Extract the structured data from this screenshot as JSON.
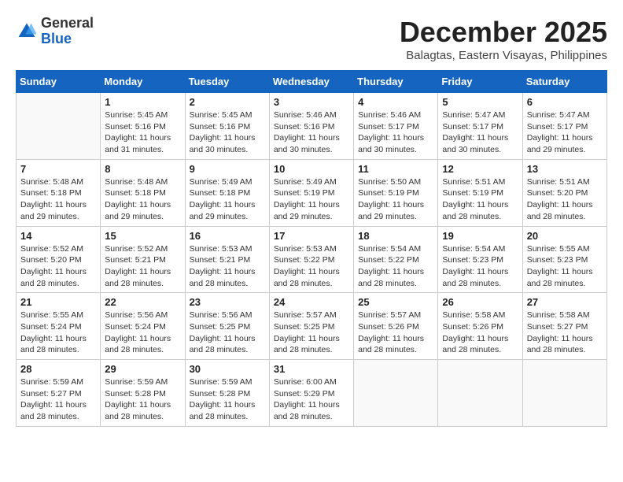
{
  "header": {
    "logo_general": "General",
    "logo_blue": "Blue",
    "month_year": "December 2025",
    "location": "Balagtas, Eastern Visayas, Philippines"
  },
  "days_of_week": [
    "Sunday",
    "Monday",
    "Tuesday",
    "Wednesday",
    "Thursday",
    "Friday",
    "Saturday"
  ],
  "weeks": [
    [
      {
        "day": "",
        "sunrise": "",
        "sunset": "",
        "daylight": ""
      },
      {
        "day": "1",
        "sunrise": "5:45 AM",
        "sunset": "5:16 PM",
        "daylight": "11 hours and 31 minutes."
      },
      {
        "day": "2",
        "sunrise": "5:45 AM",
        "sunset": "5:16 PM",
        "daylight": "11 hours and 30 minutes."
      },
      {
        "day": "3",
        "sunrise": "5:46 AM",
        "sunset": "5:16 PM",
        "daylight": "11 hours and 30 minutes."
      },
      {
        "day": "4",
        "sunrise": "5:46 AM",
        "sunset": "5:17 PM",
        "daylight": "11 hours and 30 minutes."
      },
      {
        "day": "5",
        "sunrise": "5:47 AM",
        "sunset": "5:17 PM",
        "daylight": "11 hours and 30 minutes."
      },
      {
        "day": "6",
        "sunrise": "5:47 AM",
        "sunset": "5:17 PM",
        "daylight": "11 hours and 29 minutes."
      }
    ],
    [
      {
        "day": "7",
        "sunrise": "5:48 AM",
        "sunset": "5:18 PM",
        "daylight": "11 hours and 29 minutes."
      },
      {
        "day": "8",
        "sunrise": "5:48 AM",
        "sunset": "5:18 PM",
        "daylight": "11 hours and 29 minutes."
      },
      {
        "day": "9",
        "sunrise": "5:49 AM",
        "sunset": "5:18 PM",
        "daylight": "11 hours and 29 minutes."
      },
      {
        "day": "10",
        "sunrise": "5:49 AM",
        "sunset": "5:19 PM",
        "daylight": "11 hours and 29 minutes."
      },
      {
        "day": "11",
        "sunrise": "5:50 AM",
        "sunset": "5:19 PM",
        "daylight": "11 hours and 29 minutes."
      },
      {
        "day": "12",
        "sunrise": "5:51 AM",
        "sunset": "5:19 PM",
        "daylight": "11 hours and 28 minutes."
      },
      {
        "day": "13",
        "sunrise": "5:51 AM",
        "sunset": "5:20 PM",
        "daylight": "11 hours and 28 minutes."
      }
    ],
    [
      {
        "day": "14",
        "sunrise": "5:52 AM",
        "sunset": "5:20 PM",
        "daylight": "11 hours and 28 minutes."
      },
      {
        "day": "15",
        "sunrise": "5:52 AM",
        "sunset": "5:21 PM",
        "daylight": "11 hours and 28 minutes."
      },
      {
        "day": "16",
        "sunrise": "5:53 AM",
        "sunset": "5:21 PM",
        "daylight": "11 hours and 28 minutes."
      },
      {
        "day": "17",
        "sunrise": "5:53 AM",
        "sunset": "5:22 PM",
        "daylight": "11 hours and 28 minutes."
      },
      {
        "day": "18",
        "sunrise": "5:54 AM",
        "sunset": "5:22 PM",
        "daylight": "11 hours and 28 minutes."
      },
      {
        "day": "19",
        "sunrise": "5:54 AM",
        "sunset": "5:23 PM",
        "daylight": "11 hours and 28 minutes."
      },
      {
        "day": "20",
        "sunrise": "5:55 AM",
        "sunset": "5:23 PM",
        "daylight": "11 hours and 28 minutes."
      }
    ],
    [
      {
        "day": "21",
        "sunrise": "5:55 AM",
        "sunset": "5:24 PM",
        "daylight": "11 hours and 28 minutes."
      },
      {
        "day": "22",
        "sunrise": "5:56 AM",
        "sunset": "5:24 PM",
        "daylight": "11 hours and 28 minutes."
      },
      {
        "day": "23",
        "sunrise": "5:56 AM",
        "sunset": "5:25 PM",
        "daylight": "11 hours and 28 minutes."
      },
      {
        "day": "24",
        "sunrise": "5:57 AM",
        "sunset": "5:25 PM",
        "daylight": "11 hours and 28 minutes."
      },
      {
        "day": "25",
        "sunrise": "5:57 AM",
        "sunset": "5:26 PM",
        "daylight": "11 hours and 28 minutes."
      },
      {
        "day": "26",
        "sunrise": "5:58 AM",
        "sunset": "5:26 PM",
        "daylight": "11 hours and 28 minutes."
      },
      {
        "day": "27",
        "sunrise": "5:58 AM",
        "sunset": "5:27 PM",
        "daylight": "11 hours and 28 minutes."
      }
    ],
    [
      {
        "day": "28",
        "sunrise": "5:59 AM",
        "sunset": "5:27 PM",
        "daylight": "11 hours and 28 minutes."
      },
      {
        "day": "29",
        "sunrise": "5:59 AM",
        "sunset": "5:28 PM",
        "daylight": "11 hours and 28 minutes."
      },
      {
        "day": "30",
        "sunrise": "5:59 AM",
        "sunset": "5:28 PM",
        "daylight": "11 hours and 28 minutes."
      },
      {
        "day": "31",
        "sunrise": "6:00 AM",
        "sunset": "5:29 PM",
        "daylight": "11 hours and 28 minutes."
      },
      {
        "day": "",
        "sunrise": "",
        "sunset": "",
        "daylight": ""
      },
      {
        "day": "",
        "sunrise": "",
        "sunset": "",
        "daylight": ""
      },
      {
        "day": "",
        "sunrise": "",
        "sunset": "",
        "daylight": ""
      }
    ]
  ]
}
